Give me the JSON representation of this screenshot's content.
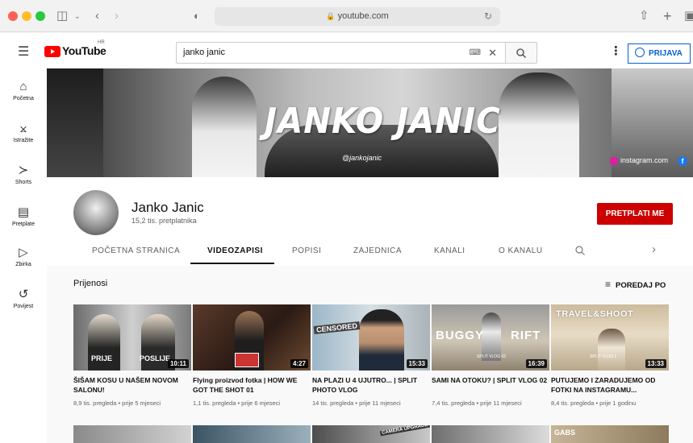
{
  "browser": {
    "url": "youtube.com"
  },
  "header": {
    "logo_text": "YouTube",
    "logo_region": "HR",
    "search_value": "janko janic",
    "login_label": "PRIJAVA"
  },
  "sidebar": {
    "items": [
      {
        "label": "Početna",
        "icon": "home-icon"
      },
      {
        "label": "Istražite",
        "icon": "compass-icon"
      },
      {
        "label": "Shorts",
        "icon": "shorts-icon"
      },
      {
        "label": "Pretplate",
        "icon": "subscriptions-icon"
      },
      {
        "label": "Zbirka",
        "icon": "library-icon"
      },
      {
        "label": "Povijest",
        "icon": "history-icon"
      }
    ]
  },
  "banner": {
    "title": "JANKO JANIC",
    "handle": "@jankojanic",
    "link": "instagram.com"
  },
  "channel": {
    "name": "Janko Janic",
    "subscribers": "15,2 tis. pretplatnika",
    "subscribe_label": "PRETPLATI ME"
  },
  "tabs": [
    "POČETNA STRANICA",
    "VIDEOZAPISI",
    "POPISI",
    "ZAJEDNICA",
    "KANALI",
    "O KANALU"
  ],
  "section": {
    "title": "Prijenosi",
    "sort_label": "POREDAJ PO"
  },
  "videos": [
    {
      "title": "ŠIŠAM KOSU U NAŠEM NOVOM SALONU!",
      "meta": "8,9 tis. pregleda • prije 5 mjeseci",
      "duration": "10:11",
      "overlay_left": "PRIJE",
      "overlay_right": "POSLIJE"
    },
    {
      "title": "Flying proizvod fotka | HOW WE GOT THE SHOT 01",
      "meta": "1,1 tis. pregleda • prije 6 mjeseci",
      "duration": "4:27"
    },
    {
      "title": "NA PLAZI U 4 UJUTRO... | SPLIT PHOTO VLOG",
      "meta": "14 tis. pregleda • prije 11 mjeseci",
      "duration": "15:33",
      "overlay_left": "CENSORED"
    },
    {
      "title": "SAMI NA OTOKU? | SPLIT VLOG 02",
      "meta": "7,4 tis. pregleda • prije 11 mjeseci",
      "duration": "16:39",
      "overlay_left": "BUGGY",
      "overlay_right": "RIFT",
      "overlay_small": "SPLIT VLOG 02"
    },
    {
      "title": "PUTUJEMO I ZARADUJEMO OD FOTKI NA INSTAGRAMU...",
      "meta": "8,4 tis. pregleda • prije 1 godinu",
      "duration": "13:33",
      "overlay_left": "TRAVEL&SHOOT",
      "overlay_small": "SPLIT VLOG 1"
    }
  ],
  "row2_overlays": {
    "third": "CAMERA UPGRADE",
    "fifth": "GABS"
  }
}
